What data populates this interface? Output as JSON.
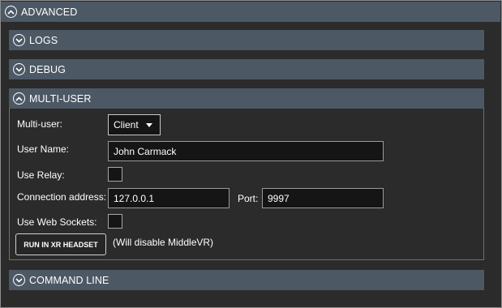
{
  "sections": {
    "advanced": {
      "label": "ADVANCED",
      "state": "expanded"
    },
    "logs": {
      "label": "LOGS",
      "state": "collapsed"
    },
    "debug": {
      "label": "DEBUG",
      "state": "collapsed"
    },
    "multi_user": {
      "label": "MULTI-USER",
      "state": "expanded"
    },
    "command_line": {
      "label": "COMMAND LINE",
      "state": "collapsed"
    }
  },
  "multi_user": {
    "mode_label": "Multi-user:",
    "mode_value": "Client",
    "user_name_label": "User Name:",
    "user_name_value": "John Carmack",
    "use_relay_label": "Use Relay:",
    "use_relay_checked": false,
    "connection_address_label": "Connection address:",
    "connection_address_value": "127.0.0.1",
    "port_label": "Port:",
    "port_value": "9997",
    "use_web_sockets_label": "Use Web Sockets:",
    "use_web_sockets_checked": false,
    "run_button_label": "RUN IN XR HEADSET",
    "run_note": "(Will disable MiddleVR)"
  },
  "colors": {
    "background": "#2b2b2b",
    "header": "#4d5865",
    "field": "#151515"
  },
  "icons": {
    "expanded": "chevron-up-circle-icon",
    "collapsed": "chevron-down-circle-icon"
  }
}
